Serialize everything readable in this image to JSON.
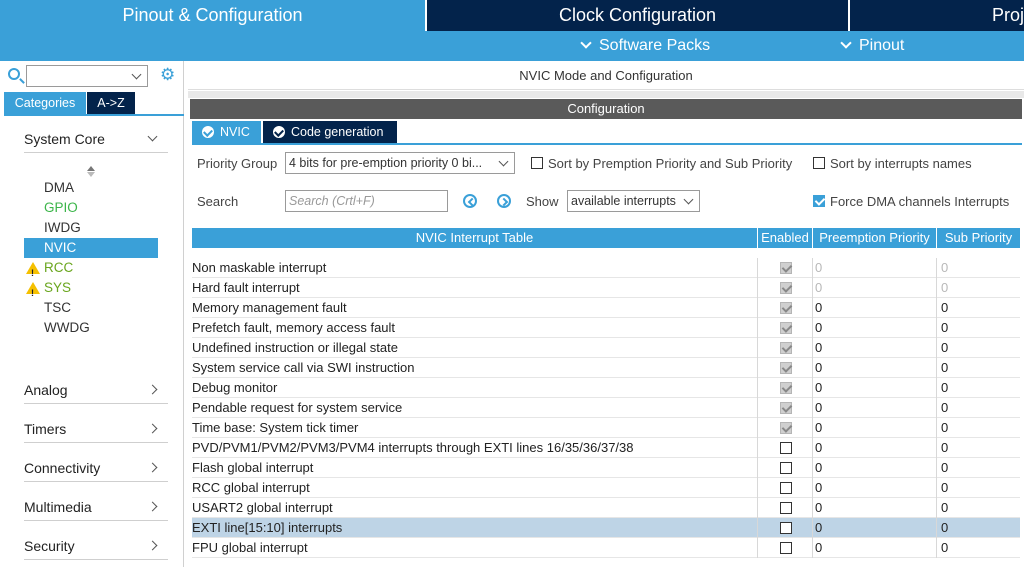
{
  "top_tabs": [
    {
      "label": "Pinout & Configuration",
      "active": true
    },
    {
      "label": "Clock Configuration",
      "active": false
    },
    {
      "label": "Proj",
      "active": false
    }
  ],
  "sub_menu": {
    "software_packs": "Software Packs",
    "pinout": "Pinout"
  },
  "left_panel": {
    "search_value": "",
    "category_tabs": [
      "Categories",
      "A->Z"
    ],
    "system_core": "System Core",
    "peripherals": [
      {
        "label": "DMA",
        "status": "normal"
      },
      {
        "label": "GPIO",
        "status": "green"
      },
      {
        "label": "IWDG",
        "status": "normal"
      },
      {
        "label": "NVIC",
        "status": "selected"
      },
      {
        "label": "RCC",
        "status": "warning"
      },
      {
        "label": "SYS",
        "status": "warning"
      },
      {
        "label": "TSC",
        "status": "normal"
      },
      {
        "label": "WWDG",
        "status": "normal"
      }
    ],
    "groups": [
      "Analog",
      "Timers",
      "Connectivity",
      "Multimedia",
      "Security"
    ]
  },
  "main": {
    "mode_title": "NVIC Mode and Configuration",
    "config_bar": "Configuration",
    "tabs": [
      "NVIC",
      "Code generation"
    ],
    "priority_group_label": "Priority Group",
    "priority_group_value": "4 bits for pre-emption priority 0 bi...",
    "sort_premption_label": "Sort by Premption Priority and Sub Priority",
    "sort_premption_checked": false,
    "sort_names_label": "Sort by interrupts names",
    "sort_names_checked": false,
    "search_label": "Search",
    "search_placeholder": "Search (Crtl+F)",
    "show_label": "Show",
    "show_value": "available interrupts",
    "force_dma_label": "Force DMA channels Interrupts",
    "force_dma_checked": true,
    "table": {
      "headers": [
        "NVIC Interrupt Table",
        "Enabled",
        "Preemption Priority",
        "Sub Priority"
      ],
      "rows": [
        {
          "name": "Non maskable interrupt",
          "enabled": true,
          "locked": true,
          "preemption": "0",
          "sub": "0"
        },
        {
          "name": "Hard fault interrupt",
          "enabled": true,
          "locked": true,
          "preemption": "0",
          "sub": "0"
        },
        {
          "name": "Memory management fault",
          "enabled": true,
          "locked": false,
          "preemption": "0",
          "sub": "0"
        },
        {
          "name": "Prefetch fault, memory access fault",
          "enabled": true,
          "locked": false,
          "preemption": "0",
          "sub": "0"
        },
        {
          "name": "Undefined instruction or illegal state",
          "enabled": true,
          "locked": false,
          "preemption": "0",
          "sub": "0"
        },
        {
          "name": "System service call via SWI instruction",
          "enabled": true,
          "locked": false,
          "preemption": "0",
          "sub": "0"
        },
        {
          "name": "Debug monitor",
          "enabled": true,
          "locked": false,
          "preemption": "0",
          "sub": "0"
        },
        {
          "name": "Pendable request for system service",
          "enabled": true,
          "locked": false,
          "preemption": "0",
          "sub": "0"
        },
        {
          "name": "Time base: System tick timer",
          "enabled": true,
          "locked": false,
          "preemption": "0",
          "sub": "0"
        },
        {
          "name": "PVD/PVM1/PVM2/PVM3/PVM4 interrupts through EXTI lines 16/35/36/37/38",
          "enabled": false,
          "locked": false,
          "preemption": "0",
          "sub": "0"
        },
        {
          "name": "Flash global interrupt",
          "enabled": false,
          "locked": false,
          "preemption": "0",
          "sub": "0"
        },
        {
          "name": "RCC global interrupt",
          "enabled": false,
          "locked": false,
          "preemption": "0",
          "sub": "0"
        },
        {
          "name": "USART2 global interrupt",
          "enabled": false,
          "locked": false,
          "preemption": "0",
          "sub": "0"
        },
        {
          "name": "EXTI line[15:10] interrupts",
          "enabled": false,
          "locked": false,
          "preemption": "0",
          "sub": "0",
          "selected": true
        },
        {
          "name": "FPU global interrupt",
          "enabled": false,
          "locked": false,
          "preemption": "0",
          "sub": "0"
        }
      ]
    }
  },
  "colors": {
    "dark_navy": "#03234b",
    "accent_blue": "#3aa0d8",
    "selected_row": "#bed4e6",
    "gpio_green": "#3cb54a",
    "warning_yellow": "#f5c000"
  }
}
